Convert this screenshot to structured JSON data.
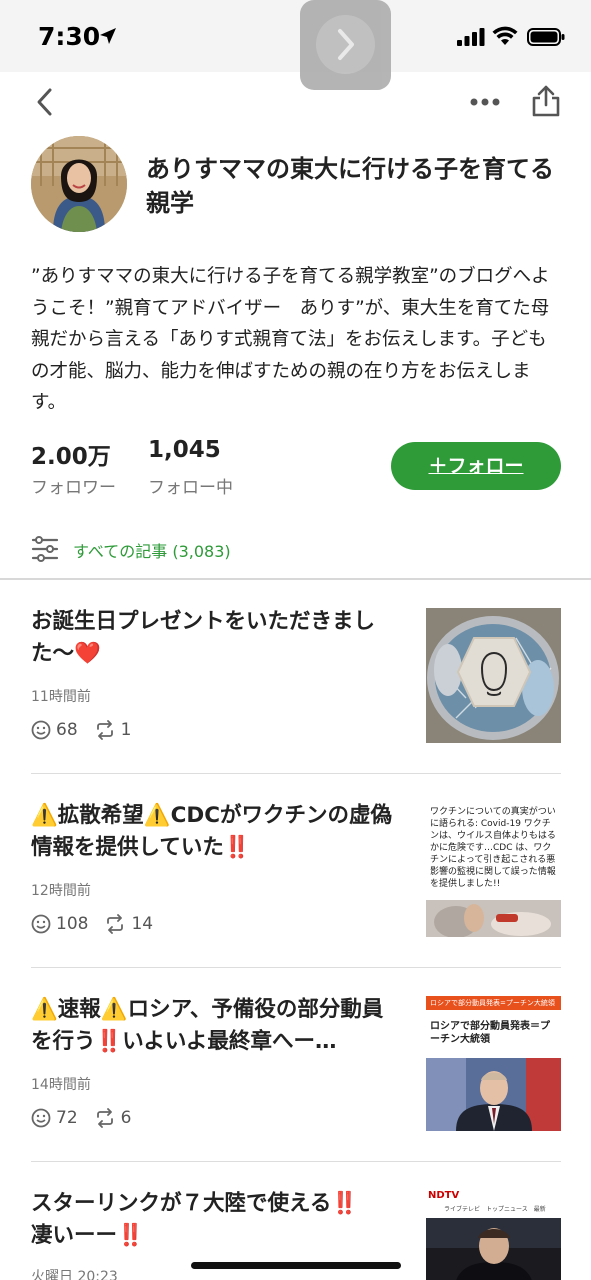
{
  "status_bar": {
    "time": "7:30"
  },
  "blog": {
    "title": "ありすママの東大に行ける子を育てる親学",
    "description": "”ありすママの東大に行ける子を育てる親学教室”のブログへようこそ！”親育てアドバイザー　ありす”が、東大生を育てた母親だから言える「ありす式親育て法」をお伝えします。子どもの才能、脳力、能力を伸ばすための親の在り方をお伝えします。",
    "followers_count": "2.00万",
    "followers_label": "フォロワー",
    "following_count": "1,045",
    "following_label": "フォロー中",
    "follow_button": "＋フォロー",
    "all_articles": "すべての記事 (3,083)"
  },
  "articles": [
    {
      "title": "お誕生日プレゼントをいただきました〜",
      "emoji_end": "❤️",
      "time": "11時間前",
      "likes": "68",
      "reblogs": "1"
    },
    {
      "prefix_warn": "⚠️",
      "title_a": "拡散希望",
      "title_b": "CDCがワクチンの虚偽情報を提供していた",
      "emoji_end": "‼️",
      "time": "12時間前",
      "likes": "108",
      "reblogs": "14",
      "thumb_text": "ワクチンについての真実がついに語られる: Covid-19 ワクチンは、ウイルス自体よりもはるかに危険です…CDC は、ワクチンによって引き起こされる悪影響の監視に関して誤った情報を提供しました!!"
    },
    {
      "title_a": "速報",
      "title_b": "ロシア、予備役の部分動員を行う",
      "title_c": "いよいよ最終章へー…",
      "time": "14時間前",
      "likes": "72",
      "reblogs": "6",
      "thumb_header": "ロシアで部分動員発表=プーチン大統領",
      "thumb_headline": "ロシアで部分動員発表＝プーチン大統領"
    },
    {
      "title_a": "スターリンクが７大陸で使える",
      "title_b": "凄いーー",
      "time": "火曜日 20:23",
      "thumb_brand": "NDTV",
      "thumb_tabs": [
        "ライブテレビ",
        "トップニュース",
        "最新"
      ]
    }
  ],
  "icons": {
    "back": "chevron-left-icon",
    "more": "more-dots-icon",
    "share": "share-icon",
    "filter": "filter-sliders-icon",
    "like": "smile-icon",
    "reblog": "reblog-icon"
  },
  "colors": {
    "accent": "#2e9b38",
    "warn": "#f0b400",
    "alert": "#d62020"
  }
}
